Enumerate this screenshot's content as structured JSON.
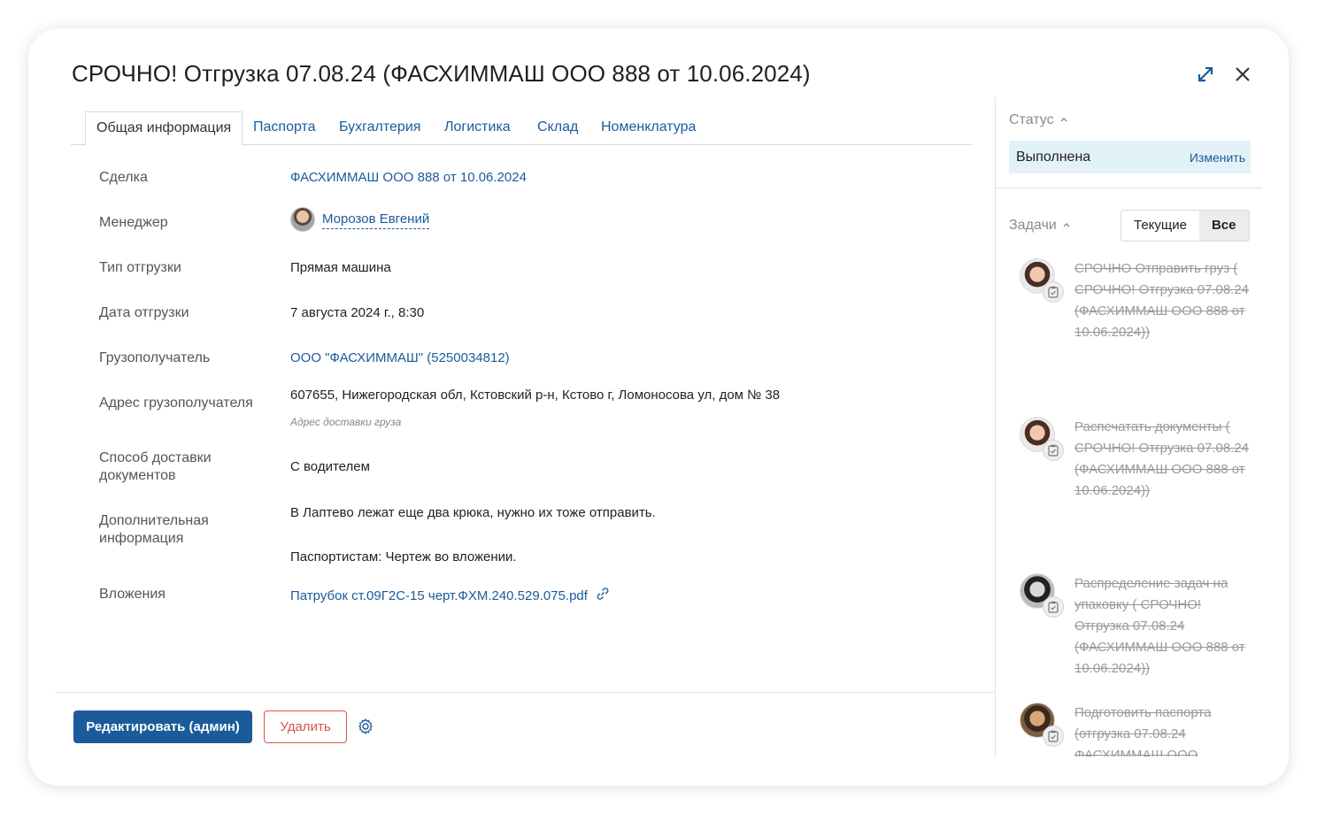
{
  "title": "СРОЧНО! Отгрузка 07.08.24 (ФАСХИММАШ ООО 888 от 10.06.2024)",
  "tabs": [
    {
      "label": "Общая информация"
    },
    {
      "label": "Паспорта"
    },
    {
      "label": "Бухгалтерия"
    },
    {
      "label": "Логистика"
    },
    {
      "label": "Склад"
    },
    {
      "label": "Номенклатура"
    }
  ],
  "fields": {
    "deal": {
      "label": "Сделка",
      "value": "ФАСХИММАШ ООО 888 от 10.06.2024"
    },
    "manager": {
      "label": "Менеджер",
      "value": "Морозов Евгений"
    },
    "shipment_type": {
      "label": "Тип отгрузки",
      "value": "Прямая машина"
    },
    "shipment_date": {
      "label": "Дата отгрузки",
      "value": "7 августа 2024 г., 8:30"
    },
    "consignee": {
      "label": "Грузополучатель",
      "value": "ООО \"ФАСХИММАШ\" (5250034812)"
    },
    "consignee_address": {
      "label": "Адрес грузополучателя",
      "value": "607655, Нижегородская обл, Кстовский р-н, Кстово г, Ломоносова ул, дом № 38",
      "hint": "Адрес доставки груза"
    },
    "doc_delivery": {
      "label": "Способ доставки документов",
      "value": "С водителем"
    },
    "additional": {
      "label": "Дополнительная информация",
      "line1": "В Лаптево лежат еще два крюка, нужно их тоже отправить.",
      "line2": "Паспортистам: Чертеж во вложении."
    },
    "attachments": {
      "label": "Вложения",
      "value": "Патрубок ст.09Г2С-15 черт.ФХМ.240.529.075.pdf"
    }
  },
  "buttons": {
    "edit": "Редактировать (админ)",
    "delete": "Удалить"
  },
  "status": {
    "label": "Статус",
    "value": "Выполнена",
    "change": "Изменить"
  },
  "tasks_panel": {
    "label": "Задачи",
    "filter_current": "Текущие",
    "filter_all": "Все",
    "tasks": [
      {
        "text": "СРОЧНО Отправить груз ( СРОЧНО! Отгрузка 07.08.24 (ФАСХИММАШ ООО 888 от 10.06.2024))"
      },
      {
        "text": "Распечатать документы ( СРОЧНО! Отгрузка 07.08.24 (ФАСХИММАШ ООО 888 от 10.06.2024))"
      },
      {
        "text": "Распределение задач на упаковку ( СРОЧНО! Отгрузка 07.08.24 (ФАСХИММАШ ООО 888 от 10.06.2024))"
      },
      {
        "text": "Подготовить паспорта (отгрузка 07.08.24 ФАСХИММАШ ООО"
      }
    ]
  },
  "colors": {
    "accent": "#1b5b9a",
    "danger": "#d9534f",
    "status_bg": "#e3f1f9"
  }
}
